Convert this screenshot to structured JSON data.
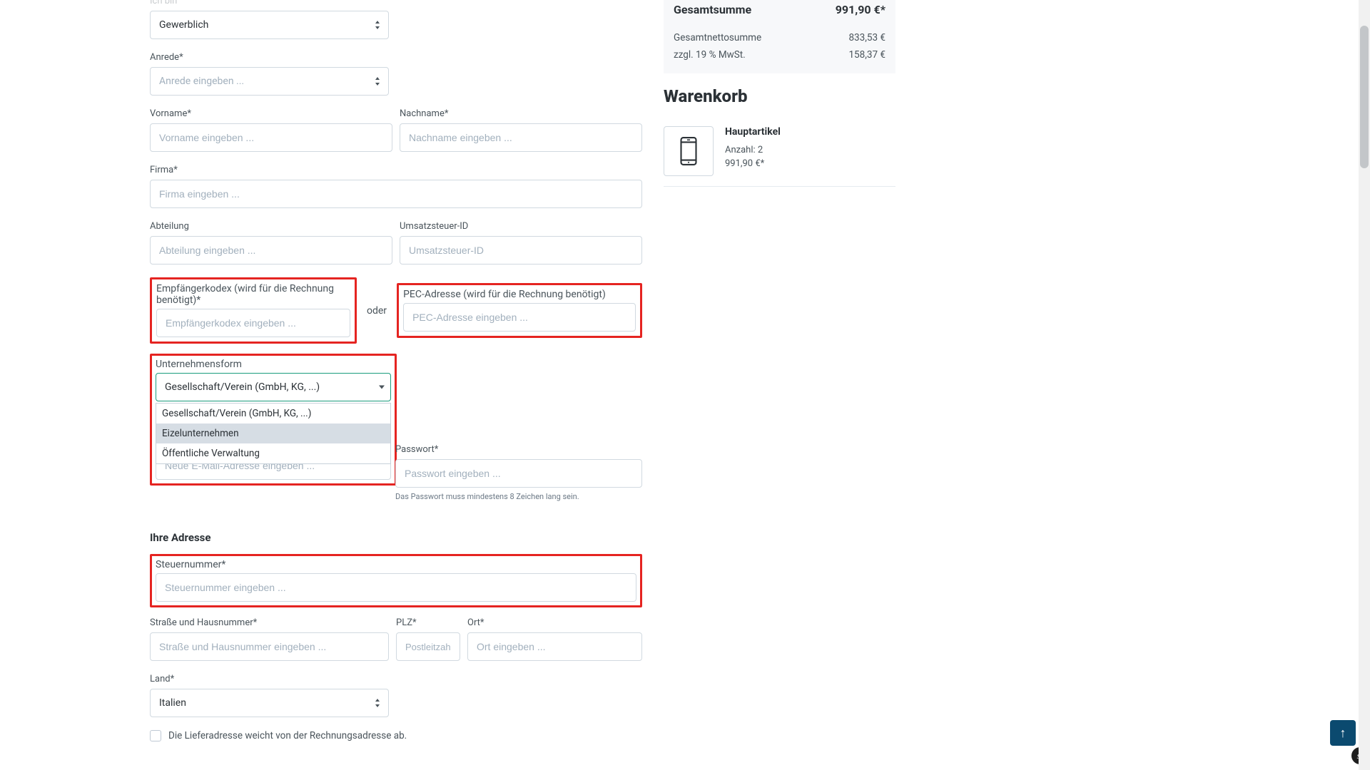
{
  "form": {
    "ich_bin": {
      "label": "Ich bin",
      "value": "Gewerblich"
    },
    "anrede": {
      "label": "Anrede*",
      "placeholder": "Anrede eingeben ..."
    },
    "vorname": {
      "label": "Vorname*",
      "placeholder": "Vorname eingeben ..."
    },
    "nachname": {
      "label": "Nachname*",
      "placeholder": "Nachname eingeben ..."
    },
    "firma": {
      "label": "Firma*",
      "placeholder": "Firma eingeben ..."
    },
    "abteilung": {
      "label": "Abteilung",
      "placeholder": "Abteilung eingeben ..."
    },
    "ust": {
      "label": "Umsatzsteuer-ID",
      "placeholder": "Umsatzsteuer-ID"
    },
    "empfaenger": {
      "label": "Empfängerkodex (wird für die Rechnung benötigt)*",
      "placeholder": "Empfängerkodex eingeben ..."
    },
    "oder": "oder",
    "pec": {
      "label": "PEC-Adresse (wird für die Rechnung benötigt)",
      "placeholder": "PEC-Adresse eingeben ..."
    },
    "utf": {
      "label": "Unternehmensform",
      "value": "Gesellschaft/Verein (GmbH, KG, ...)",
      "options": [
        "Gesellschaft/Verein (GmbH, KG, ...)",
        "Eizelunternehmen",
        "Öffentliche Verwaltung"
      ]
    },
    "email": {
      "label": "",
      "placeholder": "Neue E-Mail-Adresse eingeben ..."
    },
    "passwort": {
      "label": "Passwort*",
      "placeholder": "Passwort eingeben ...",
      "hint": "Das Passwort muss mindestens 8 Zeichen lang sein."
    },
    "ihre_adresse": "Ihre Adresse",
    "steuer": {
      "label": "Steuernummer*",
      "placeholder": "Steuernummer eingeben ..."
    },
    "strasse": {
      "label": "Straße und Hausnummer*",
      "placeholder": "Straße und Hausnummer eingeben ..."
    },
    "plz": {
      "label": "PLZ*",
      "placeholder": "Postleitzahl eingeben ..."
    },
    "ort": {
      "label": "Ort*",
      "placeholder": "Ort eingeben ..."
    },
    "land": {
      "label": "Land*",
      "value": "Italien"
    },
    "diff_shipping": "Die Lieferadresse weicht von der Rechnungsadresse ab."
  },
  "summary": {
    "total_label": "Gesamtsumme",
    "total_value": "991,90 €*",
    "net_label": "Gesamtnettosumme",
    "net_value": "833,53 €",
    "vat_label": "zzgl. 19 % MwSt.",
    "vat_value": "158,37 €"
  },
  "cart": {
    "title": "Warenkorb",
    "item": {
      "name": "Hauptartikel",
      "qty_label": "Anzahl: 2",
      "price": "991,90 €*"
    }
  }
}
